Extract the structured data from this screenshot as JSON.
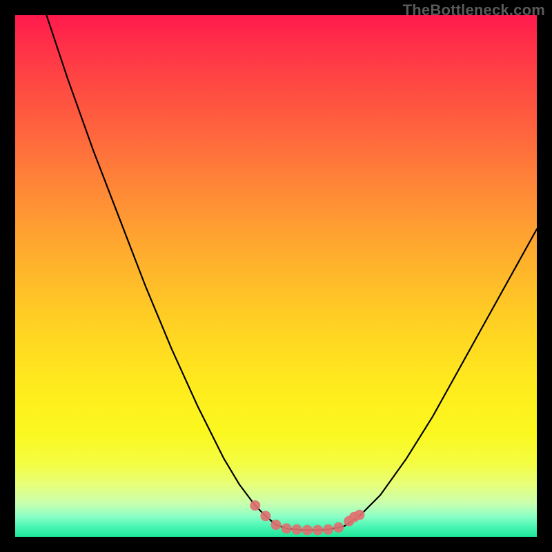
{
  "watermark": "TheBottleneck.com",
  "chart_data": {
    "type": "line",
    "title": "",
    "xlabel": "",
    "ylabel": "",
    "xlim": [
      0,
      100
    ],
    "ylim": [
      0,
      100
    ],
    "grid": false,
    "legend": false,
    "series": [
      {
        "name": "curve",
        "color": "#000000",
        "x": [
          6,
          10,
          15,
          20,
          25,
          30,
          35,
          40,
          43,
          46,
          48,
          50,
          52,
          55,
          58,
          60,
          63,
          66,
          70,
          75,
          80,
          85,
          90,
          95,
          100
        ],
        "y": [
          100,
          88,
          74,
          61,
          48,
          36,
          25,
          15,
          10,
          6,
          4,
          2.3,
          1.6,
          1.3,
          1.3,
          1.4,
          2.0,
          4.0,
          8.0,
          15,
          23,
          32,
          41,
          50,
          59
        ]
      }
    ],
    "markers": {
      "name": "highlight-dots",
      "color": "#e07070",
      "points": [
        {
          "x": 46,
          "y": 6.0
        },
        {
          "x": 48,
          "y": 4.0
        },
        {
          "x": 50,
          "y": 2.3
        },
        {
          "x": 52,
          "y": 1.6
        },
        {
          "x": 54,
          "y": 1.4
        },
        {
          "x": 56,
          "y": 1.3
        },
        {
          "x": 58,
          "y": 1.3
        },
        {
          "x": 60,
          "y": 1.4
        },
        {
          "x": 62,
          "y": 1.8
        },
        {
          "x": 64,
          "y": 3.0
        },
        {
          "x": 65,
          "y": 3.8
        },
        {
          "x": 66,
          "y": 4.2
        }
      ]
    }
  },
  "layout": {
    "image_size": 800,
    "border": 22,
    "plot_size": 756
  }
}
